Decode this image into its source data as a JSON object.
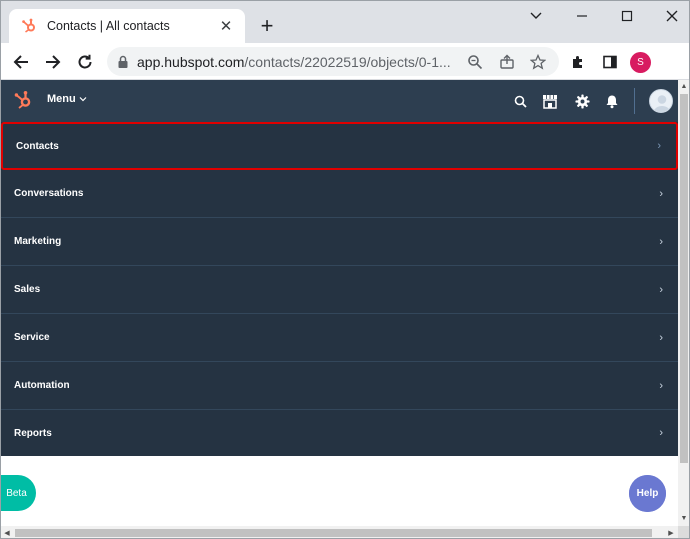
{
  "browser": {
    "tab_title": "Contacts | All contacts",
    "tab_close_glyph": "✕",
    "new_tab_glyph": "+",
    "url_host": "app.hubspot.com",
    "url_path": "/contacts/22022519/objects/0-1...",
    "profile_initial": "S",
    "colors": {
      "profile": "#d81b60",
      "tabstrip": "#dee1e6"
    }
  },
  "hubspot_nav": {
    "menu_label": "Menu",
    "colors": {
      "nav_bg": "#2d3e50",
      "brand": "#ff7a59"
    }
  },
  "menu": {
    "items": [
      {
        "label": "Contacts",
        "selected": true
      },
      {
        "label": "Conversations",
        "selected": false
      },
      {
        "label": "Marketing",
        "selected": false
      },
      {
        "label": "Sales",
        "selected": false
      },
      {
        "label": "Service",
        "selected": false
      },
      {
        "label": "Automation",
        "selected": false
      },
      {
        "label": "Reports",
        "selected": false
      }
    ],
    "chevron_glyph": "›",
    "colors": {
      "list_bg": "#253342",
      "highlight": "#e00000"
    }
  },
  "floating": {
    "beta_label": "Beta",
    "help_label": "Help",
    "colors": {
      "beta": "#00bda5",
      "help": "#6a78d1"
    }
  }
}
